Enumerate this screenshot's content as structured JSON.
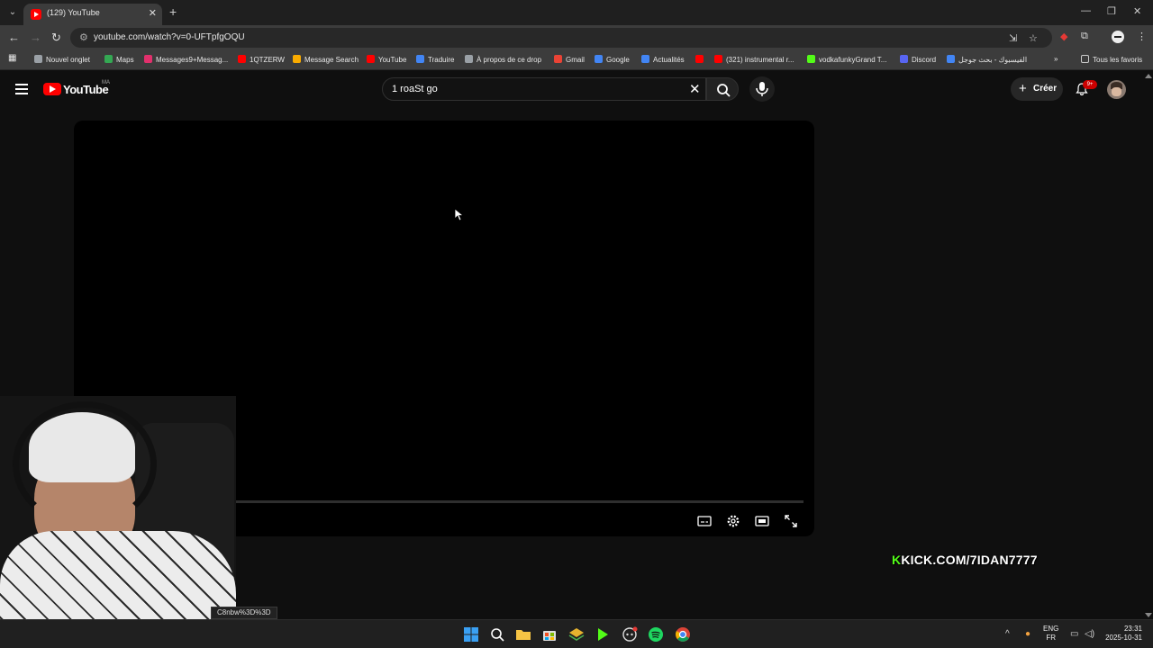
{
  "browser": {
    "tab_title": "(129) YouTube",
    "url": "youtube.com/watch?v=0-UFTpfgOQU",
    "bookmarks": [
      {
        "label": "Nouvel onglet",
        "color": "#9aa0a6"
      },
      {
        "label": "Maps",
        "color": "#34a853"
      },
      {
        "label": "Messages9+Messag...",
        "color": "#e1306c"
      },
      {
        "label": "1QTZERW",
        "color": "#ff0000"
      },
      {
        "label": "Message Search",
        "color": "#f9ab00"
      },
      {
        "label": "YouTube",
        "color": "#ff0000"
      },
      {
        "label": "Traduire",
        "color": "#4285f4"
      },
      {
        "label": "À propos de ce drop",
        "color": "#9aa0a6"
      },
      {
        "label": "Gmail",
        "color": "#ea4335"
      },
      {
        "label": "Google",
        "color": "#4285f4"
      },
      {
        "label": "Actualités",
        "color": "#4285f4"
      },
      {
        "label": "(321) instrumental r...",
        "color": "#ff0000"
      },
      {
        "label": "vodkafunkyGrand T...",
        "color": "#53fc18"
      },
      {
        "label": "Discord",
        "color": "#5865f2"
      },
      {
        "label": "الفيسبوك - بحث جوجل",
        "color": "#4285f4"
      }
    ],
    "all_bookmarks": "Tous les favoris"
  },
  "youtube": {
    "logo_text": "YouTube",
    "country_code": "MA",
    "search_query": "1 roaSt go",
    "create_label": "Créer",
    "notifications_badge": "9+"
  },
  "status_url": "C8nbw%3D%3D",
  "overlay": {
    "kick_k": "K",
    "kick_text": "KICK.COM/7IDAN7777"
  },
  "taskbar": {
    "lang_top": "ENG",
    "lang_bottom": "FR",
    "time": "23:31",
    "date": "2025-10-31"
  },
  "colors": {
    "youtube_red": "#ff0000",
    "kick_green": "#53fc18",
    "background": "#0f0f0f"
  }
}
